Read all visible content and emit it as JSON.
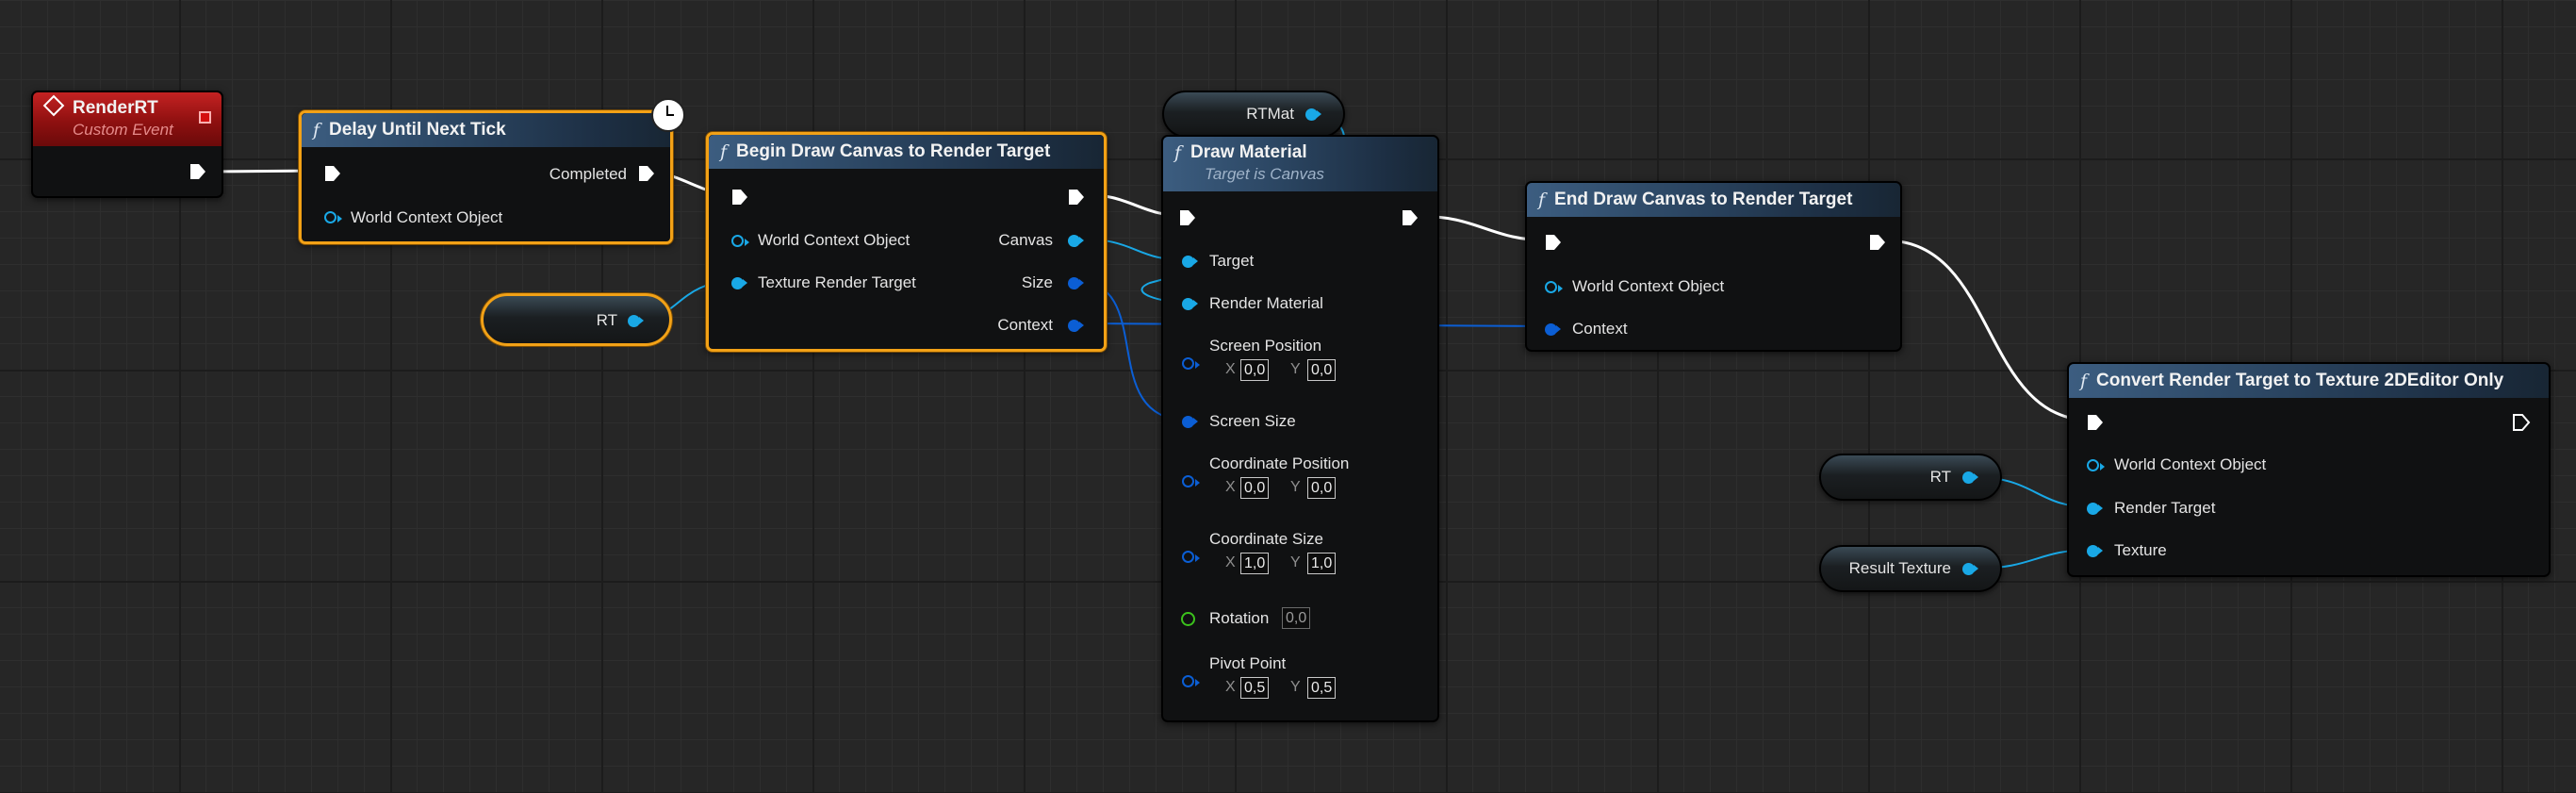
{
  "colors": {
    "exec_wire": "#ffffff",
    "object_wire": "#19a8e6",
    "struct_wire": "#0b5ed4",
    "selection": "#f2a116",
    "event_header": "#b01818",
    "function_header": "#2f4f70"
  },
  "nodes": {
    "render_rt": {
      "title": "RenderRT",
      "subtitle": "Custom Event"
    },
    "delay": {
      "title": "Delay Until Next Tick",
      "pins": {
        "completed": "Completed",
        "world_context": "World Context Object"
      }
    },
    "begin_draw": {
      "title": "Begin Draw Canvas to Render Target",
      "pins": {
        "world_context": "World Context Object",
        "texture_rt": "Texture Render Target",
        "canvas": "Canvas",
        "size": "Size",
        "context": "Context"
      }
    },
    "draw_material": {
      "title": "Draw Material",
      "subtitle": "Target is Canvas",
      "pins": {
        "target": "Target",
        "render_material": "Render Material",
        "screen_position": "Screen Position",
        "screen_size": "Screen Size",
        "coordinate_position": "Coordinate Position",
        "coordinate_size": "Coordinate Size",
        "rotation": "Rotation",
        "pivot_point": "Pivot Point"
      },
      "values": {
        "screen_position_x": "0,0",
        "screen_position_y": "0,0",
        "coordinate_position_x": "0,0",
        "coordinate_position_y": "0,0",
        "coordinate_size_x": "1,0",
        "coordinate_size_y": "1,0",
        "rotation": "0,0",
        "pivot_point_x": "0,5",
        "pivot_point_y": "0,5"
      },
      "axis_x": "X",
      "axis_y": "Y"
    },
    "end_draw": {
      "title": "End Draw Canvas to Render Target",
      "pins": {
        "world_context": "World Context Object",
        "context": "Context"
      }
    },
    "convert": {
      "title": "Convert Render Target to Texture 2DEditor Only",
      "pins": {
        "world_context": "World Context Object",
        "render_target": "Render Target",
        "texture": "Texture"
      }
    }
  },
  "variables": {
    "rtmat": "RTMat",
    "rt_1": "RT",
    "rt_2": "RT",
    "result_texture": "Result Texture"
  },
  "icons": {
    "function": "function-icon",
    "event": "event-icon",
    "latent": "clock-icon",
    "stop": "stop-icon"
  }
}
